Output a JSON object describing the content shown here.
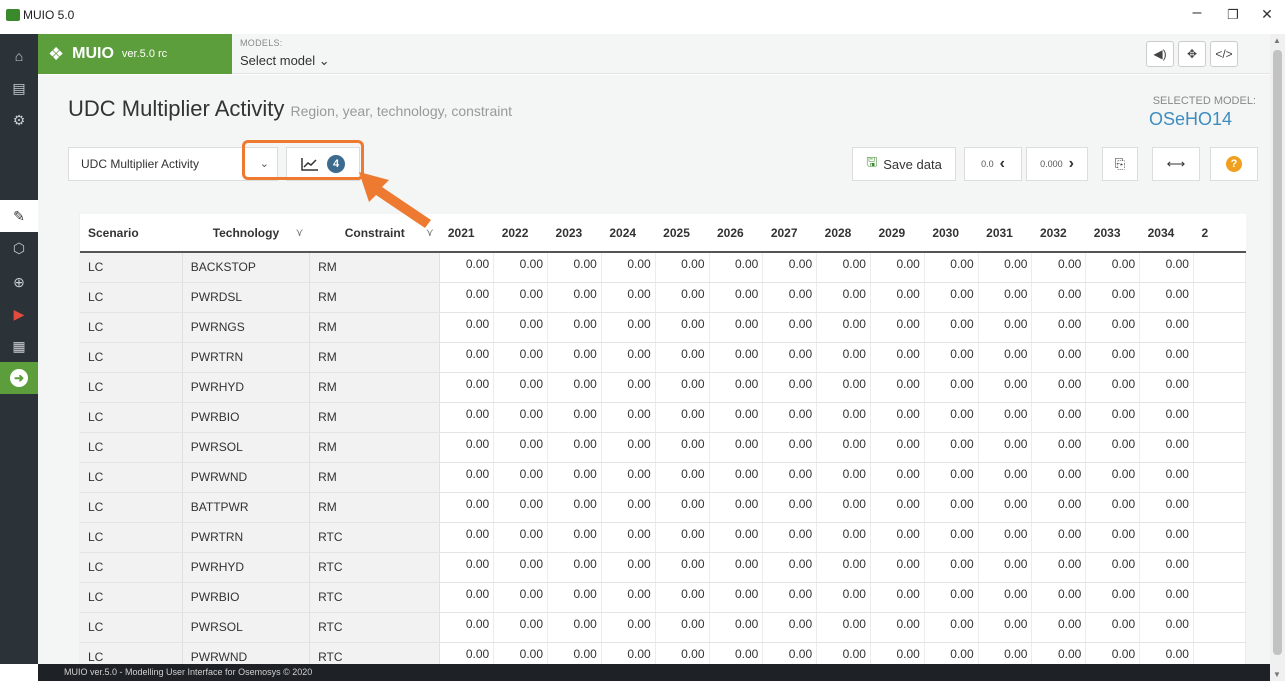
{
  "window": {
    "title": "MUIO 5.0",
    "min": "–",
    "max": "❐",
    "close": "✕"
  },
  "brand": {
    "name": "MUIO",
    "version": "ver.5.0 rc"
  },
  "models": {
    "label": "MODELS:",
    "selected": "Select model ⌄"
  },
  "top_buttons": [
    {
      "name": "sound-button",
      "icon": "🔊"
    },
    {
      "name": "fullscreen-button",
      "icon": "⤧"
    },
    {
      "name": "code-button",
      "icon": "</>"
    }
  ],
  "sidebar": [
    "home-icon",
    "document-icon",
    "gears-icon",
    "edit-icon",
    "hexagon-icon",
    "search-plus-icon",
    "run-icon",
    "table-icon",
    "next-icon"
  ],
  "page": {
    "title": "UDC Multiplier Activity",
    "subtitle": "Region, year, technology, constraint",
    "selected_model_label": "SELECTED MODEL:",
    "selected_model": "OSeHO14"
  },
  "toolbar": {
    "param_select": "UDC Multiplier Activity",
    "chart_badge": "4",
    "save_label": "Save data",
    "dec_small": "0.0",
    "inc_small": "0.000"
  },
  "table": {
    "headers": [
      "Scenario",
      "Technology",
      "Constraint"
    ],
    "years": [
      "2021",
      "2022",
      "2023",
      "2024",
      "2025",
      "2026",
      "2027",
      "2028",
      "2029",
      "2030",
      "2031",
      "2032",
      "2033",
      "2034",
      "2"
    ],
    "rows": [
      [
        "LC",
        "BACKSTOP",
        "RM"
      ],
      [
        "LC",
        "PWRDSL",
        "RM"
      ],
      [
        "LC",
        "PWRNGS",
        "RM"
      ],
      [
        "LC",
        "PWRTRN",
        "RM"
      ],
      [
        "LC",
        "PWRHYD",
        "RM"
      ],
      [
        "LC",
        "PWRBIO",
        "RM"
      ],
      [
        "LC",
        "PWRSOL",
        "RM"
      ],
      [
        "LC",
        "PWRWND",
        "RM"
      ],
      [
        "LC",
        "BATTPWR",
        "RM"
      ],
      [
        "LC",
        "PWRTRN",
        "RTC"
      ],
      [
        "LC",
        "PWRHYD",
        "RTC"
      ],
      [
        "LC",
        "PWRBIO",
        "RTC"
      ],
      [
        "LC",
        "PWRSOL",
        "RTC"
      ],
      [
        "LC",
        "PWRWND",
        "RTC"
      ]
    ],
    "cell_value": "0.00"
  },
  "footer": "MUIO ver.5.0 - Modelling User Interface for Osemosys © 2020",
  "accent": "#5c9e3c",
  "highlight_color": "#ee7a31"
}
